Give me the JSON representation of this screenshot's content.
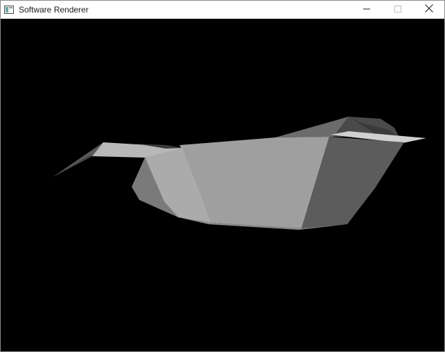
{
  "window": {
    "title": "Software Renderer",
    "app_icon": "window-app-icon",
    "controls": {
      "minimize_icon": "minimize-icon",
      "maximize_icon": "maximize-icon",
      "close_icon": "close-icon"
    }
  },
  "viewport": {
    "background_color": "#000000",
    "model": "flat-shaded-gray-mesh",
    "face_colors": [
      "#5b5b5b",
      "#6f6f6f",
      "#878787",
      "#9c9c9c",
      "#ababab",
      "#bdbdbd",
      "#d0d0d0",
      "#3f3f3f"
    ]
  }
}
